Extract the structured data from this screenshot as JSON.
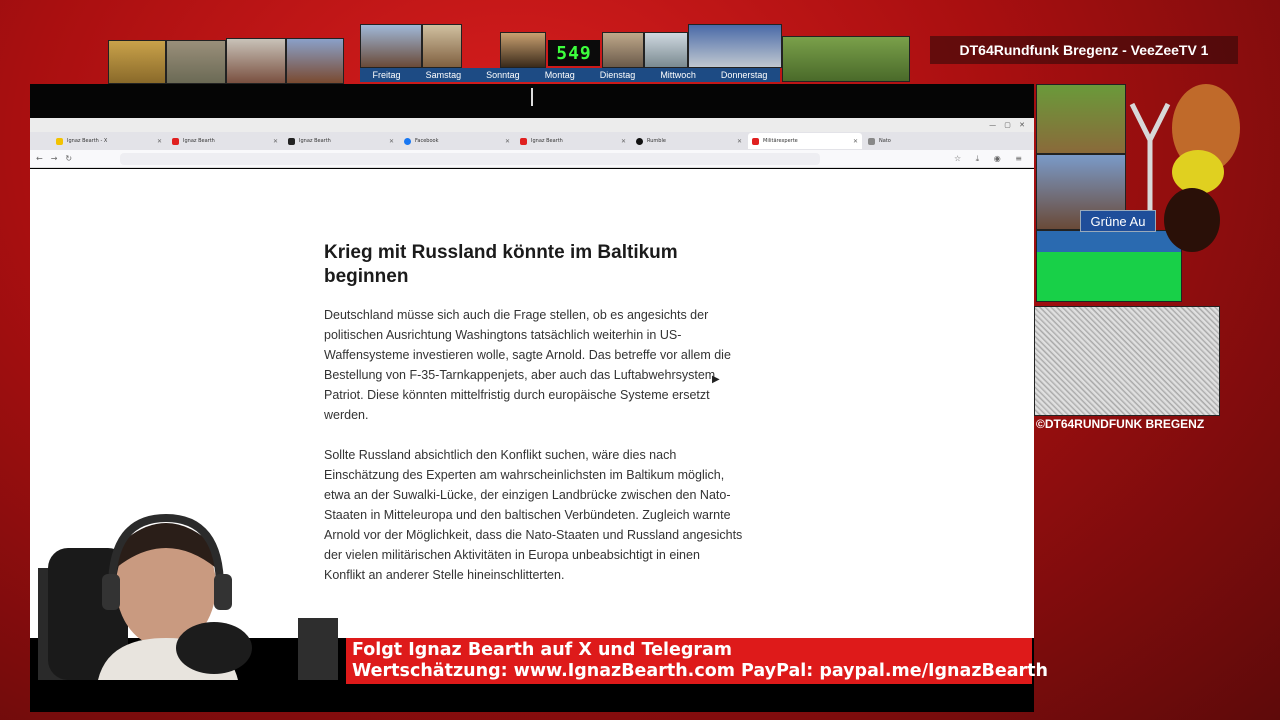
{
  "channel": {
    "title": "DT64Rundfunk Bregenz - VeeZeeTV 1",
    "copyright": "©DT64RUNDFUNK BREGENZ"
  },
  "clock": "549",
  "weekdays": [
    "Freitag",
    "Samstag",
    "Sonntag",
    "Montag",
    "Dienstag",
    "Mittwoch",
    "Donnerstag"
  ],
  "side_panel": {
    "label": "Grüne Au"
  },
  "browser": {
    "tabs": [
      {
        "label": "Ignaz Bearth - X",
        "color": "#f2c200",
        "active": false
      },
      {
        "label": "Ignaz Bearth",
        "color": "#e02020",
        "active": false
      },
      {
        "label": "Ignaz Bearth",
        "color": "#222222",
        "active": false
      },
      {
        "label": "Facebook",
        "color": "#1877f2",
        "active": false
      },
      {
        "label": "Ignaz Bearth",
        "color": "#e02020",
        "active": false
      },
      {
        "label": "Rumble",
        "color": "#111111",
        "active": false
      },
      {
        "label": "Militärexperte",
        "color": "#e02020",
        "active": true
      },
      {
        "label": "Nato",
        "color": "#888888",
        "active": false
      }
    ]
  },
  "article": {
    "headline": "Krieg mit Russland könnte im Baltikum beginnen",
    "paragraphs": [
      "Deutschland müsse sich auch die Frage stellen, ob es angesichts der politischen Ausrichtung Washingtons tatsächlich weiterhin in US-Waffensysteme investieren wolle, sagte Arnold. Das betreffe vor allem die Bestellung von F-35-Tarnkappenjets, aber auch das Luftabwehrsystem Patriot. Diese könnten mittelfristig durch europäische Systeme ersetzt werden.",
      "Sollte Russland absichtlich den Konflikt suchen, wäre dies nach Einschätzung des Experten am wahrscheinlichsten im Baltikum möglich, etwa an der Suwalki-Lücke, der einzigen Landbrücke zwischen den Nato-Staaten in Mitteleuropa und den baltischen Verbündeten. Zugleich warnte Arnold vor der Möglichkeit, dass die Nato-Staaten und Russland angesichts der vielen militärischen Aktivitäten in Europa unbeabsichtigt in einen Konflikt an anderer Stelle hineinschlitterten."
    ]
  },
  "ticker": {
    "line1": "Folgt Ignaz Bearth auf X und Telegram",
    "line2": "Wertschätzung: www.IgnazBearth.com PayPal: paypal.me/IgnazBearth"
  }
}
